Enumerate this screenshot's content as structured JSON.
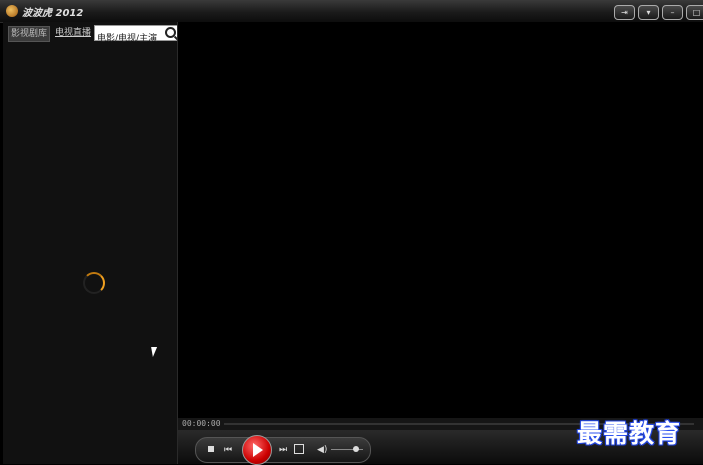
{
  "app": {
    "title": "波波虎 2012"
  },
  "window_buttons": [
    "pin",
    "menu",
    "minimize",
    "maximize"
  ],
  "left_panel": {
    "tabs": [
      {
        "label": "影视剧库"
      },
      {
        "label": "电视直播"
      }
    ],
    "search": {
      "value": "电影/电视/主演"
    }
  },
  "player": {
    "time": "00:00:00",
    "volume": 0.75
  },
  "watermark": "最需教育",
  "icons": [
    "logo-icon",
    "search-icon",
    "expand-icon",
    "stop-icon",
    "prev-icon",
    "play-icon",
    "next-icon",
    "fullscreen-icon",
    "volume-icon",
    "spinner-icon",
    "cursor-icon"
  ]
}
